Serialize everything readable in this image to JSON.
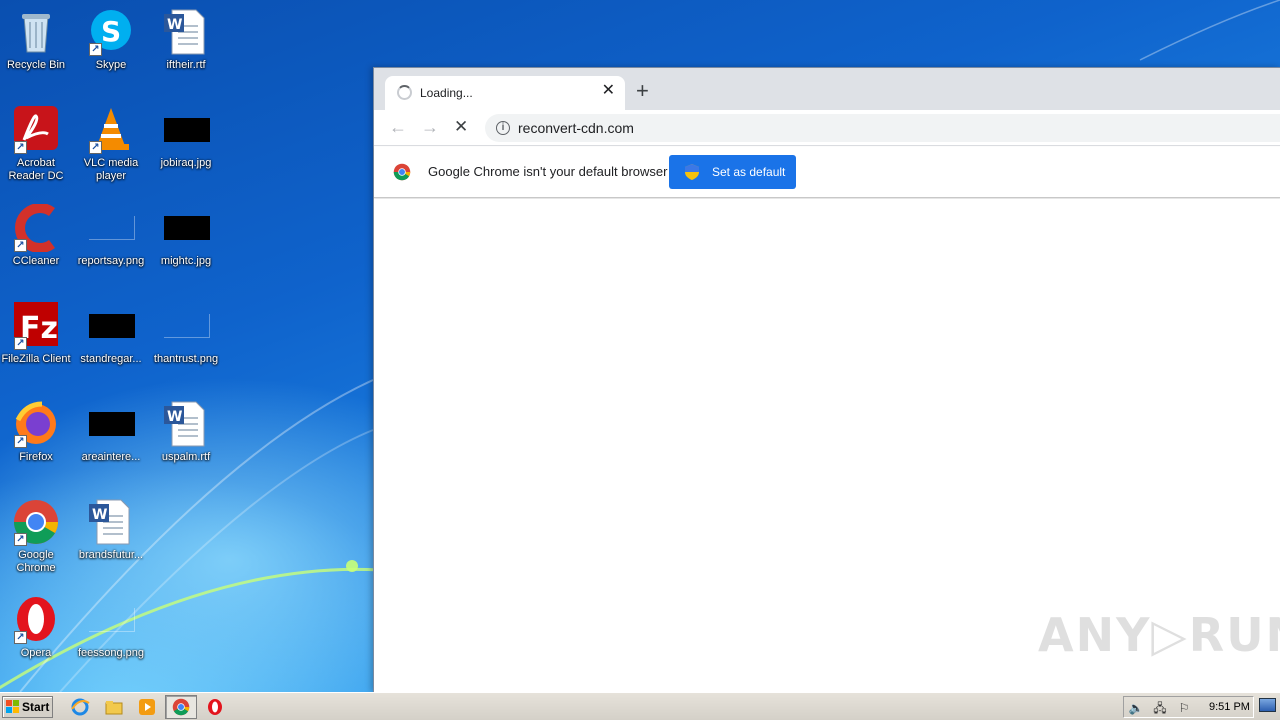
{
  "desktop": {
    "icons": [
      {
        "label": "Recycle Bin"
      },
      {
        "label": "Skype"
      },
      {
        "label": "iftheir.rtf"
      },
      {
        "label": "Acrobat Reader DC"
      },
      {
        "label": "VLC media player"
      },
      {
        "label": "jobiraq.jpg"
      },
      {
        "label": "CCleaner"
      },
      {
        "label": "reportsay.png"
      },
      {
        "label": "mightc.jpg"
      },
      {
        "label": "FileZilla Client"
      },
      {
        "label": "standregar..."
      },
      {
        "label": "thantrust.png"
      },
      {
        "label": "Firefox"
      },
      {
        "label": "areaintere..."
      },
      {
        "label": "uspalm.rtf"
      },
      {
        "label": "Google Chrome"
      },
      {
        "label": "brandsfutur..."
      },
      {
        "label": "Opera"
      },
      {
        "label": "feessong.png"
      }
    ]
  },
  "browser": {
    "tab": {
      "title": "Loading...",
      "close_glyph": "✕"
    },
    "new_tab_glyph": "+",
    "toolbar": {
      "back_glyph": "←",
      "forward_glyph": "→",
      "stop_glyph": "✕"
    },
    "address": {
      "url": "reconvert-cdn.com",
      "info_glyph": "i"
    },
    "infobar": {
      "message": "Google Chrome isn't your default browser",
      "button_label": "Set as default"
    }
  },
  "watermark": {
    "text": "ANY▷RUN"
  },
  "taskbar": {
    "start_label": "Start",
    "clock": "9:51 PM"
  },
  "colors": {
    "accent_button": "#1a73e8",
    "tabstrip": "#dee1e6",
    "omnibox": "#f1f3f4",
    "taskbar": "#d4d0c8"
  }
}
